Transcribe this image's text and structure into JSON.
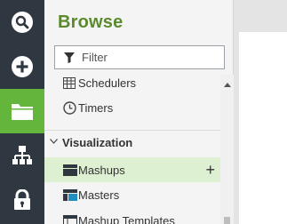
{
  "rail": {
    "items": [
      {
        "icon": "search-icon",
        "active": false
      },
      {
        "icon": "add-icon",
        "active": false
      },
      {
        "icon": "folder-icon",
        "active": true
      },
      {
        "icon": "hierarchy-icon",
        "active": false
      },
      {
        "icon": "lock-icon",
        "active": false
      }
    ]
  },
  "browse": {
    "title": "Browse",
    "filter_placeholder": "Filter",
    "items": [
      {
        "label": "Schedulers",
        "icon": "grid-icon"
      },
      {
        "label": "Timers",
        "icon": "clock-icon"
      }
    ],
    "section": {
      "label": "Visualization",
      "expanded": true
    },
    "section_items": [
      {
        "label": "Mashups",
        "icon": "mashup-icon",
        "selected": true,
        "action": "+"
      },
      {
        "label": "Masters",
        "icon": "master-icon",
        "selected": false
      },
      {
        "label": "Mashup Templates",
        "icon": "template-icon",
        "selected": false
      }
    ]
  },
  "colors": {
    "rail_bg": "#2f3841",
    "accent": "#63b53c",
    "title": "#5b8a2e",
    "selected_row": "#def0d2"
  }
}
